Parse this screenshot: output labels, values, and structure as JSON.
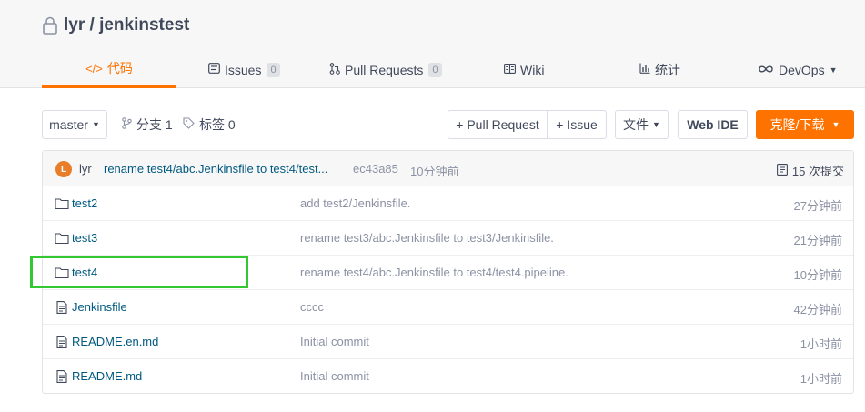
{
  "repo": {
    "title": "lyr / jenkinstest"
  },
  "tabs": [
    {
      "label": "代码",
      "icon": "code-icon"
    },
    {
      "label": "Issues",
      "count": "0",
      "icon": "issues-icon"
    },
    {
      "label": "Pull Requests",
      "count": "0",
      "icon": "pull-request-icon"
    },
    {
      "label": "Wiki",
      "icon": "wiki-icon"
    },
    {
      "label": "统计",
      "icon": "stats-icon"
    },
    {
      "label": "DevOps",
      "icon": "devops-icon"
    }
  ],
  "toolbar": {
    "branch": "master",
    "branches": "分支 1",
    "tags": "标签 0",
    "pull_request": "+ Pull Request",
    "issue": "+ Issue",
    "file": "文件",
    "web_ide": "Web IDE",
    "clone": "克隆/下载"
  },
  "commit": {
    "avatar": "L",
    "author": "lyr",
    "message": "rename test4/abc.Jenkinsfile to test4/test...",
    "sha": "ec43a85",
    "time": "10分钟前",
    "commits": "15 次提交"
  },
  "files": [
    {
      "name": "test2",
      "type": "folder",
      "message": "add test2/Jenkinsfile.",
      "time": "27分钟前"
    },
    {
      "name": "test3",
      "type": "folder",
      "message": "rename test3/abc.Jenkinsfile to test3/Jenkinsfile.",
      "time": "21分钟前"
    },
    {
      "name": "test4",
      "type": "folder",
      "message": "rename test4/abc.Jenkinsfile to test4/test4.pipeline.",
      "time": "10分钟前"
    },
    {
      "name": "Jenkinsfile",
      "type": "file",
      "message": "cccc",
      "time": "42分钟前"
    },
    {
      "name": "README.en.md",
      "type": "file",
      "message": "Initial commit",
      "time": "1小时前"
    },
    {
      "name": "README.md",
      "type": "file",
      "message": "Initial commit",
      "time": "1小时前"
    }
  ],
  "colors": {
    "accent": "#fe7300",
    "link": "#005980",
    "highlight": "#32c832"
  }
}
